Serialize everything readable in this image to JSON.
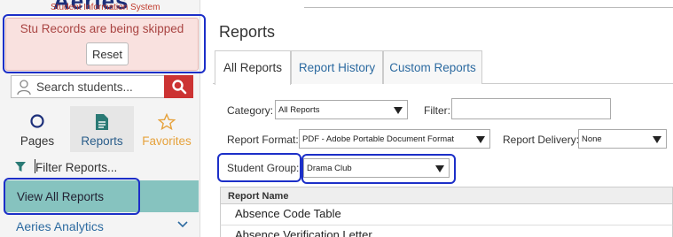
{
  "sidebar": {
    "logo_text": "Aeries",
    "logo_subtitle": "Student Information System",
    "alert": {
      "message": "Stu Records are being skipped",
      "button_label": "Reset"
    },
    "search": {
      "placeholder": "Search students..."
    },
    "nav_tabs": [
      {
        "label": "Pages",
        "icon": "circle-icon"
      },
      {
        "label": "Reports",
        "icon": "document-icon"
      },
      {
        "label": "Favorites",
        "icon": "star-icon"
      }
    ],
    "filter": {
      "placeholder": "Filter Reports..."
    },
    "view_all_label": "View All Reports",
    "analytics_label": "Aeries Analytics"
  },
  "main": {
    "title": "Reports",
    "tabs": [
      "All Reports",
      "Report History",
      "Custom Reports"
    ],
    "form": {
      "category_label": "Category:",
      "category_value": "All Reports",
      "filter_label": "Filter:",
      "report_format_label": "Report Format:",
      "report_format_value": "PDF - Adobe Portable Document Format",
      "report_delivery_label": "Report Delivery:",
      "report_delivery_value": "None",
      "student_group_label": "Student Group:",
      "student_group_value": "Drama Club"
    },
    "table": {
      "header": "Report Name",
      "rows": [
        "Absence Code Table",
        "Absence Verification Letter"
      ]
    }
  },
  "colors": {
    "accent_red": "#cc3333",
    "highlight_blue": "#1c2fc8",
    "teal_selected": "#86c3bf",
    "link_blue": "#2c6aa0",
    "alert_bg": "#f9e1df",
    "alert_text": "#a94442",
    "favorites_orange": "#e6a23c"
  }
}
